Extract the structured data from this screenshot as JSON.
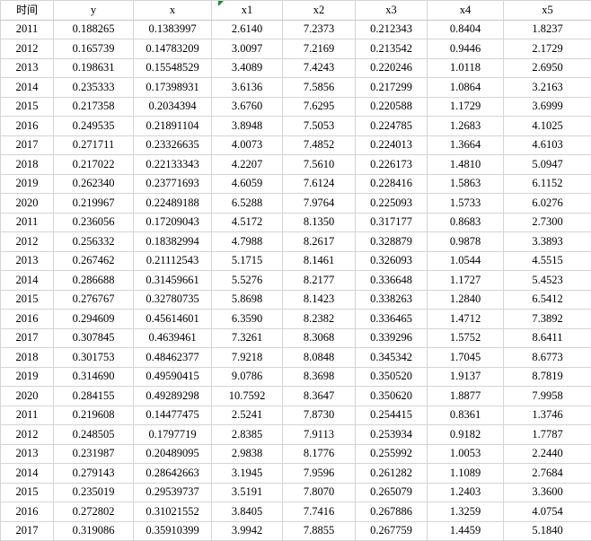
{
  "headers": [
    "时间",
    "y",
    "x",
    "x1",
    "x2",
    "x3",
    "x4",
    "x5"
  ],
  "rows": [
    [
      "2011",
      "0.188265",
      "0.1383997",
      "2.6140",
      "7.2373",
      "0.212343",
      "0.8404",
      "1.8237"
    ],
    [
      "2012",
      "0.165739",
      "0.14783209",
      "3.0097",
      "7.2169",
      "0.213542",
      "0.9446",
      "2.1729"
    ],
    [
      "2013",
      "0.198631",
      "0.15548529",
      "3.4089",
      "7.4243",
      "0.220246",
      "1.0118",
      "2.6950"
    ],
    [
      "2014",
      "0.235333",
      "0.17398931",
      "3.6136",
      "7.5856",
      "0.217299",
      "1.0864",
      "3.2163"
    ],
    [
      "2015",
      "0.217358",
      "0.2034394",
      "3.6760",
      "7.6295",
      "0.220588",
      "1.1729",
      "3.6999"
    ],
    [
      "2016",
      "0.249535",
      "0.21891104",
      "3.8948",
      "7.5053",
      "0.224785",
      "1.2683",
      "4.1025"
    ],
    [
      "2017",
      "0.271711",
      "0.23326635",
      "4.0073",
      "7.4852",
      "0.224013",
      "1.3664",
      "4.6103"
    ],
    [
      "2018",
      "0.217022",
      "0.22133343",
      "4.2207",
      "7.5610",
      "0.226173",
      "1.4810",
      "5.0947"
    ],
    [
      "2019",
      "0.262340",
      "0.23771693",
      "4.6059",
      "7.6124",
      "0.228416",
      "1.5863",
      "6.1152"
    ],
    [
      "2020",
      "0.219967",
      "0.22489188",
      "6.5288",
      "7.9764",
      "0.225093",
      "1.5733",
      "6.0276"
    ],
    [
      "2011",
      "0.236056",
      "0.17209043",
      "4.5172",
      "8.1350",
      "0.317177",
      "0.8683",
      "2.7300"
    ],
    [
      "2012",
      "0.256332",
      "0.18382994",
      "4.7988",
      "8.2617",
      "0.328879",
      "0.9878",
      "3.3893"
    ],
    [
      "2013",
      "0.267462",
      "0.21112543",
      "5.1715",
      "8.1461",
      "0.326093",
      "1.0544",
      "4.5515"
    ],
    [
      "2014",
      "0.286688",
      "0.31459661",
      "5.5276",
      "8.2177",
      "0.336648",
      "1.1727",
      "5.4523"
    ],
    [
      "2015",
      "0.276767",
      "0.32780735",
      "5.8698",
      "8.1423",
      "0.338263",
      "1.2840",
      "6.5412"
    ],
    [
      "2016",
      "0.294609",
      "0.45614601",
      "6.3590",
      "8.2382",
      "0.336465",
      "1.4712",
      "7.3892"
    ],
    [
      "2017",
      "0.307845",
      "0.4639461",
      "7.3261",
      "8.3068",
      "0.339296",
      "1.5752",
      "8.6411"
    ],
    [
      "2018",
      "0.301753",
      "0.48462377",
      "7.9218",
      "8.0848",
      "0.345342",
      "1.7045",
      "8.6773"
    ],
    [
      "2019",
      "0.314690",
      "0.49590415",
      "9.0786",
      "8.3698",
      "0.350520",
      "1.9137",
      "8.7819"
    ],
    [
      "2020",
      "0.284155",
      "0.49289298",
      "10.7592",
      "8.3647",
      "0.350620",
      "1.8877",
      "7.9958"
    ],
    [
      "2011",
      "0.219608",
      "0.14477475",
      "2.5241",
      "7.8730",
      "0.254415",
      "0.8361",
      "1.3746"
    ],
    [
      "2012",
      "0.248505",
      "0.1797719",
      "2.8385",
      "7.9113",
      "0.253934",
      "0.9182",
      "1.7787"
    ],
    [
      "2013",
      "0.231987",
      "0.20489095",
      "2.9838",
      "8.1776",
      "0.255992",
      "1.0053",
      "2.2440"
    ],
    [
      "2014",
      "0.279143",
      "0.28642663",
      "3.1945",
      "7.9596",
      "0.261282",
      "1.1089",
      "2.7684"
    ],
    [
      "2015",
      "0.235019",
      "0.29539737",
      "3.5191",
      "7.8070",
      "0.265079",
      "1.2403",
      "3.3600"
    ],
    [
      "2016",
      "0.272802",
      "0.31021552",
      "3.8405",
      "7.7416",
      "0.267886",
      "1.3259",
      "4.0754"
    ],
    [
      "2017",
      "0.319086",
      "0.35910399",
      "3.9942",
      "7.8855",
      "0.267759",
      "1.4459",
      "5.1840"
    ]
  ]
}
